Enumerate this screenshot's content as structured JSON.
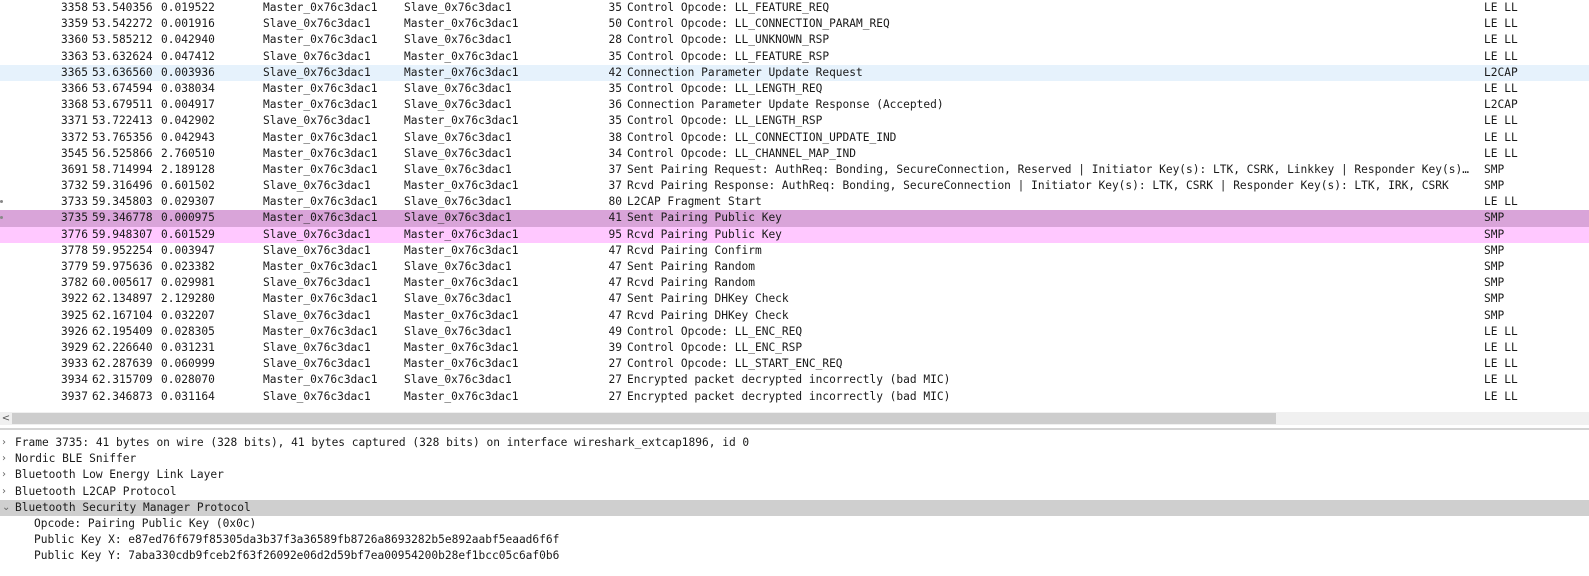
{
  "packets": [
    {
      "no": "3358",
      "time": "53.540356",
      "delta": "0.019522",
      "src": "Master_0x76c3dac1",
      "dst": "Slave_0x76c3dac1",
      "len": "35",
      "info": "Control Opcode: LL_FEATURE_REQ",
      "proto": "LE LL",
      "bg": ""
    },
    {
      "no": "3359",
      "time": "53.542272",
      "delta": "0.001916",
      "src": "Slave_0x76c3dac1",
      "dst": "Master_0x76c3dac1",
      "len": "50",
      "info": "Control Opcode: LL_CONNECTION_PARAM_REQ",
      "proto": "LE LL",
      "bg": ""
    },
    {
      "no": "3360",
      "time": "53.585212",
      "delta": "0.042940",
      "src": "Master_0x76c3dac1",
      "dst": "Slave_0x76c3dac1",
      "len": "28",
      "info": "Control Opcode: LL_UNKNOWN_RSP",
      "proto": "LE LL",
      "bg": ""
    },
    {
      "no": "3363",
      "time": "53.632624",
      "delta": "0.047412",
      "src": "Slave_0x76c3dac1",
      "dst": "Master_0x76c3dac1",
      "len": "35",
      "info": "Control Opcode: LL_FEATURE_RSP",
      "proto": "LE LL",
      "bg": ""
    },
    {
      "no": "3365",
      "time": "53.636560",
      "delta": "0.003936",
      "src": "Slave_0x76c3dac1",
      "dst": "Master_0x76c3dac1",
      "len": "42",
      "info": "Connection Parameter Update Request",
      "proto": "L2CAP",
      "bg": "l2cap"
    },
    {
      "no": "3366",
      "time": "53.674594",
      "delta": "0.038034",
      "src": "Master_0x76c3dac1",
      "dst": "Slave_0x76c3dac1",
      "len": "35",
      "info": "Control Opcode: LL_LENGTH_REQ",
      "proto": "LE LL",
      "bg": ""
    },
    {
      "no": "3368",
      "time": "53.679511",
      "delta": "0.004917",
      "src": "Master_0x76c3dac1",
      "dst": "Slave_0x76c3dac1",
      "len": "36",
      "info": "Connection Parameter Update Response (Accepted)",
      "proto": "L2CAP",
      "bg": ""
    },
    {
      "no": "3371",
      "time": "53.722413",
      "delta": "0.042902",
      "src": "Slave_0x76c3dac1",
      "dst": "Master_0x76c3dac1",
      "len": "35",
      "info": "Control Opcode: LL_LENGTH_RSP",
      "proto": "LE LL",
      "bg": ""
    },
    {
      "no": "3372",
      "time": "53.765356",
      "delta": "0.042943",
      "src": "Master_0x76c3dac1",
      "dst": "Slave_0x76c3dac1",
      "len": "38",
      "info": "Control Opcode: LL_CONNECTION_UPDATE_IND",
      "proto": "LE LL",
      "bg": ""
    },
    {
      "no": "3545",
      "time": "56.525866",
      "delta": "2.760510",
      "src": "Master_0x76c3dac1",
      "dst": "Slave_0x76c3dac1",
      "len": "34",
      "info": "Control Opcode: LL_CHANNEL_MAP_IND",
      "proto": "LE LL",
      "bg": ""
    },
    {
      "no": "3691",
      "time": "58.714994",
      "delta": "2.189128",
      "src": "Master_0x76c3dac1",
      "dst": "Slave_0x76c3dac1",
      "len": "37",
      "info": "Sent Pairing Request: AuthReq: Bonding, SecureConnection, Reserved | Initiator Key(s): LTK, CSRK, Linkkey | Responder Key(s):…",
      "proto": "SMP",
      "bg": ""
    },
    {
      "no": "3732",
      "time": "59.316496",
      "delta": "0.601502",
      "src": "Slave_0x76c3dac1",
      "dst": "Master_0x76c3dac1",
      "len": "37",
      "info": "Rcvd Pairing Response: AuthReq: Bonding, SecureConnection | Initiator Key(s): LTK, CSRK | Responder Key(s): LTK, IRK, CSRK",
      "proto": "SMP",
      "bg": ""
    },
    {
      "no": "3733",
      "time": "59.345803",
      "delta": "0.029307",
      "src": "Master_0x76c3dac1",
      "dst": "Slave_0x76c3dac1",
      "len": "80",
      "info": "L2CAP Fragment Start",
      "proto": "LE LL",
      "bg": "",
      "mark": true
    },
    {
      "no": "3735",
      "time": "59.346778",
      "delta": "0.000975",
      "src": "Master_0x76c3dac1",
      "dst": "Slave_0x76c3dac1",
      "len": "41",
      "info": "Sent Pairing Public Key",
      "proto": "SMP",
      "bg": "selected",
      "mark": true
    },
    {
      "no": "3776",
      "time": "59.948307",
      "delta": "0.601529",
      "src": "Slave_0x76c3dac1",
      "dst": "Master_0x76c3dac1",
      "len": "95",
      "info": "Rcvd Pairing Public Key",
      "proto": "SMP",
      "bg": "alt"
    },
    {
      "no": "3778",
      "time": "59.952254",
      "delta": "0.003947",
      "src": "Slave_0x76c3dac1",
      "dst": "Master_0x76c3dac1",
      "len": "47",
      "info": "Rcvd Pairing Confirm",
      "proto": "SMP",
      "bg": ""
    },
    {
      "no": "3779",
      "time": "59.975636",
      "delta": "0.023382",
      "src": "Master_0x76c3dac1",
      "dst": "Slave_0x76c3dac1",
      "len": "47",
      "info": "Sent Pairing Random",
      "proto": "SMP",
      "bg": ""
    },
    {
      "no": "3782",
      "time": "60.005617",
      "delta": "0.029981",
      "src": "Slave_0x76c3dac1",
      "dst": "Master_0x76c3dac1",
      "len": "47",
      "info": "Rcvd Pairing Random",
      "proto": "SMP",
      "bg": ""
    },
    {
      "no": "3922",
      "time": "62.134897",
      "delta": "2.129280",
      "src": "Master_0x76c3dac1",
      "dst": "Slave_0x76c3dac1",
      "len": "47",
      "info": "Sent Pairing DHKey Check",
      "proto": "SMP",
      "bg": ""
    },
    {
      "no": "3925",
      "time": "62.167104",
      "delta": "0.032207",
      "src": "Slave_0x76c3dac1",
      "dst": "Master_0x76c3dac1",
      "len": "47",
      "info": "Rcvd Pairing DHKey Check",
      "proto": "SMP",
      "bg": ""
    },
    {
      "no": "3926",
      "time": "62.195409",
      "delta": "0.028305",
      "src": "Master_0x76c3dac1",
      "dst": "Slave_0x76c3dac1",
      "len": "49",
      "info": "Control Opcode: LL_ENC_REQ",
      "proto": "LE LL",
      "bg": ""
    },
    {
      "no": "3929",
      "time": "62.226640",
      "delta": "0.031231",
      "src": "Slave_0x76c3dac1",
      "dst": "Master_0x76c3dac1",
      "len": "39",
      "info": "Control Opcode: LL_ENC_RSP",
      "proto": "LE LL",
      "bg": ""
    },
    {
      "no": "3933",
      "time": "62.287639",
      "delta": "0.060999",
      "src": "Slave_0x76c3dac1",
      "dst": "Master_0x76c3dac1",
      "len": "27",
      "info": "Control Opcode: LL_START_ENC_REQ",
      "proto": "LE LL",
      "bg": ""
    },
    {
      "no": "3934",
      "time": "62.315709",
      "delta": "0.028070",
      "src": "Master_0x76c3dac1",
      "dst": "Slave_0x76c3dac1",
      "len": "27",
      "info": "Encrypted packet decrypted incorrectly (bad MIC)",
      "proto": "LE LL",
      "bg": ""
    },
    {
      "no": "3937",
      "time": "62.346873",
      "delta": "0.031164",
      "src": "Slave_0x76c3dac1",
      "dst": "Master_0x76c3dac1",
      "len": "27",
      "info": "Encrypted packet decrypted incorrectly (bad MIC)",
      "proto": "LE LL",
      "bg": ""
    }
  ],
  "scrollbar": {
    "left_arrow": "<"
  },
  "details": [
    {
      "text": "Frame 3735: 41 bytes on wire (328 bits), 41 bytes captured (328 bits) on interface wireshark_extcap1896, id 0",
      "toggle": "›",
      "level": 0
    },
    {
      "text": "Nordic BLE Sniffer",
      "toggle": "›",
      "level": 0
    },
    {
      "text": "Bluetooth Low Energy Link Layer",
      "toggle": "›",
      "level": 0
    },
    {
      "text": "Bluetooth L2CAP Protocol",
      "toggle": "›",
      "level": 0
    },
    {
      "text": "Bluetooth Security Manager Protocol",
      "toggle": "⌄",
      "level": 0,
      "selected": true
    },
    {
      "text": "Opcode: Pairing Public Key (0x0c)",
      "toggle": "",
      "level": 1
    },
    {
      "text": "Public Key X: e87ed76f679f85305da3b37f3a36589fb8726a8693282b5e892aabf5eaad6f6f",
      "toggle": "",
      "level": 1
    },
    {
      "text": "Public Key Y: 7aba330cdb9fceb2f63f26092e06d2d59bf7ea00954200b28ef1bcc05c6af0b6",
      "toggle": "",
      "level": 1
    }
  ],
  "colors": {
    "l2cap_bg": "#e6f2fc",
    "selected_bg": "#d9a4d9",
    "smp_alt_bg": "#ffc8ff",
    "detail_selected_bg": "#cfcfcf"
  }
}
